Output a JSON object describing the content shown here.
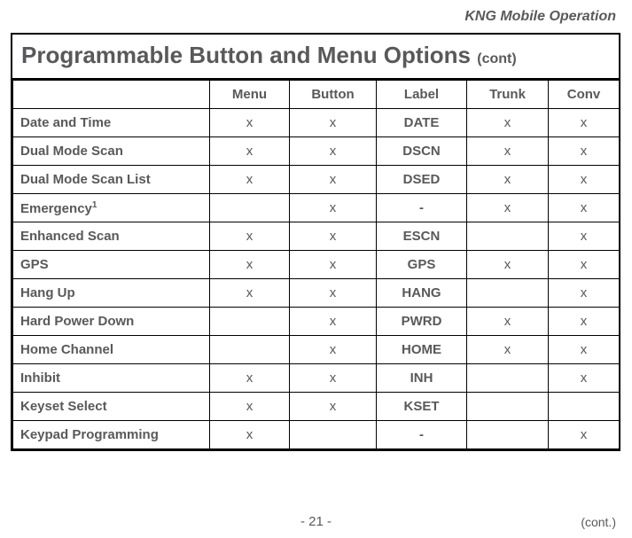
{
  "header": {
    "right": "KNG Mobile Operation"
  },
  "title": {
    "main": "Programmable Button and Menu Options ",
    "cont": "(cont)"
  },
  "columns": {
    "feature": "",
    "menu": "Menu",
    "button": "Button",
    "label": "Label",
    "trunk": "Trunk",
    "conv": "Conv"
  },
  "rows": [
    {
      "feature": "Date and Time",
      "sup": "",
      "menu": "x",
      "button": "x",
      "label": "DATE",
      "trunk": "x",
      "conv": "x"
    },
    {
      "feature": "Dual Mode Scan",
      "sup": "",
      "menu": "x",
      "button": "x",
      "label": "DSCN",
      "trunk": "x",
      "conv": "x"
    },
    {
      "feature": "Dual Mode Scan List",
      "sup": "",
      "menu": "x",
      "button": "x",
      "label": "DSED",
      "trunk": "x",
      "conv": "x"
    },
    {
      "feature": "Emergency",
      "sup": "1",
      "menu": "",
      "button": "x",
      "label": "-",
      "trunk": "x",
      "conv": "x"
    },
    {
      "feature": "Enhanced Scan",
      "sup": "",
      "menu": "x",
      "button": "x",
      "label": "ESCN",
      "trunk": "",
      "conv": "x"
    },
    {
      "feature": "GPS",
      "sup": "",
      "menu": "x",
      "button": "x",
      "label": "GPS",
      "trunk": "x",
      "conv": "x"
    },
    {
      "feature": "Hang Up",
      "sup": "",
      "menu": "x",
      "button": "x",
      "label": "HANG",
      "trunk": "",
      "conv": "x"
    },
    {
      "feature": "Hard Power Down",
      "sup": "",
      "menu": "",
      "button": "x",
      "label": "PWRD",
      "trunk": "x",
      "conv": "x"
    },
    {
      "feature": "Home Channel",
      "sup": "",
      "menu": "",
      "button": "x",
      "label": "HOME",
      "trunk": "x",
      "conv": "x"
    },
    {
      "feature": "Inhibit",
      "sup": "",
      "menu": "x",
      "button": "x",
      "label": "INH",
      "trunk": "",
      "conv": "x"
    },
    {
      "feature": "Keyset Select",
      "sup": "",
      "menu": "x",
      "button": "x",
      "label": "KSET",
      "trunk": "",
      "conv": ""
    },
    {
      "feature": "Keypad Programming",
      "sup": "",
      "menu": "x",
      "button": "",
      "label": "-",
      "trunk": "",
      "conv": "x"
    }
  ],
  "footer": {
    "page": "- 21 -",
    "cont": "(cont.)"
  }
}
